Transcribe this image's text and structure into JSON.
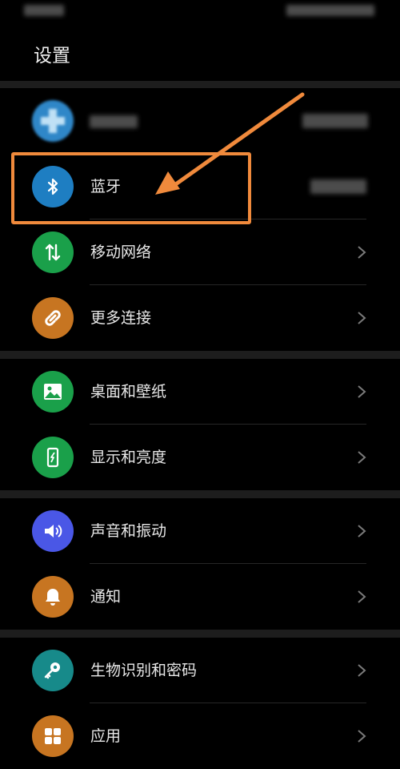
{
  "page": {
    "title": "设置"
  },
  "rows": [
    {
      "id": "account",
      "label": "",
      "icon": "user-avatar",
      "color": "#2f87c8"
    },
    {
      "id": "bluetooth",
      "label": "蓝牙",
      "icon": "bluetooth-icon",
      "color": "#1e7ec2"
    },
    {
      "id": "mobile-network",
      "label": "移动网络",
      "icon": "mobile-data-icon",
      "color": "#1aa04a"
    },
    {
      "id": "more-connections",
      "label": "更多连接",
      "icon": "link-icon",
      "color": "#c77521"
    },
    {
      "id": "wallpaper",
      "label": "桌面和壁纸",
      "icon": "image-icon",
      "color": "#1aa04a"
    },
    {
      "id": "display",
      "label": "显示和亮度",
      "icon": "phone-brightness-icon",
      "color": "#1aa04a"
    },
    {
      "id": "sound",
      "label": "声音和振动",
      "icon": "speaker-icon",
      "color": "#4a57e6"
    },
    {
      "id": "notifications",
      "label": "通知",
      "icon": "bell-icon",
      "color": "#c77521"
    },
    {
      "id": "biometrics",
      "label": "生物识别和密码",
      "icon": "key-icon",
      "color": "#178a8a"
    },
    {
      "id": "apps",
      "label": "应用",
      "icon": "apps-grid-icon",
      "color": "#c77521"
    }
  ],
  "colors": {
    "highlight": "#f08a3c",
    "chevron": "#7a7a7a",
    "background": "#000000"
  }
}
